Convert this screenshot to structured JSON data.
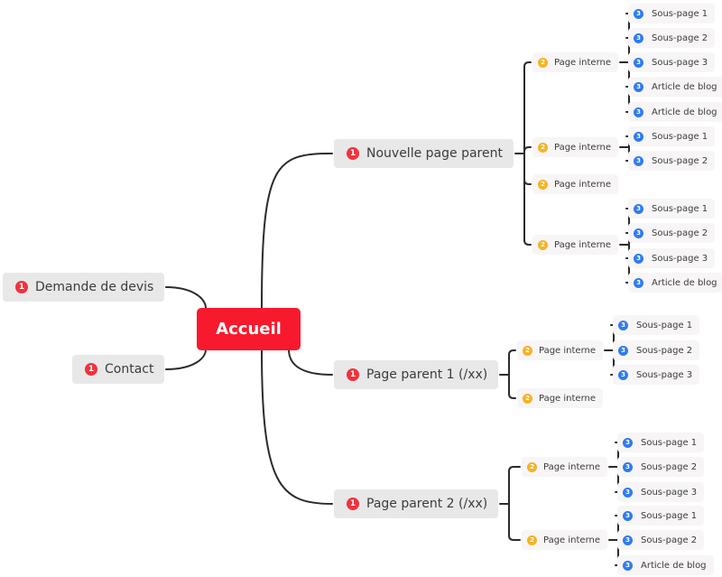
{
  "colors": {
    "root": "#f7192d",
    "level1_badge": "#f0323c",
    "level2_badge": "#f5b324",
    "level3_badge": "#2f7bf0",
    "connector": "#2b2b2b"
  },
  "badges": {
    "level1": "1",
    "level2": "2",
    "level3": "3"
  },
  "mindmap": {
    "root": {
      "label": "Accueil"
    },
    "left": [
      {
        "label": "Demande de devis"
      },
      {
        "label": "Contact"
      }
    ],
    "right": [
      {
        "label": "Nouvelle page parent",
        "children": [
          {
            "label": "Page interne",
            "children": [
              "Sous-page 1",
              "Sous-page 2",
              "Sous-page 3",
              "Article de blog",
              "Article de blog"
            ]
          },
          {
            "label": "Page interne",
            "children": [
              "Sous-page 1",
              "Sous-page 2"
            ]
          },
          {
            "label": "Page interne",
            "children": []
          },
          {
            "label": "Page interne",
            "children": [
              "Sous-page 1",
              "Sous-page 2",
              "Sous-page 3",
              "Article de blog"
            ]
          }
        ]
      },
      {
        "label": "Page parent 1 (/xx)",
        "children": [
          {
            "label": "Page interne",
            "children": [
              "Sous-page 1",
              "Sous-page 2",
              "Sous-page 3"
            ]
          },
          {
            "label": "Page interne",
            "children": []
          }
        ]
      },
      {
        "label": "Page parent 2 (/xx)",
        "children": [
          {
            "label": "Page interne",
            "children": [
              "Sous-page 1",
              "Sous-page 2",
              "Sous-page 3"
            ]
          },
          {
            "label": "Page interne",
            "children": [
              "Sous-page 1",
              "Sous-page 2",
              "Article de blog"
            ]
          }
        ]
      }
    ]
  }
}
